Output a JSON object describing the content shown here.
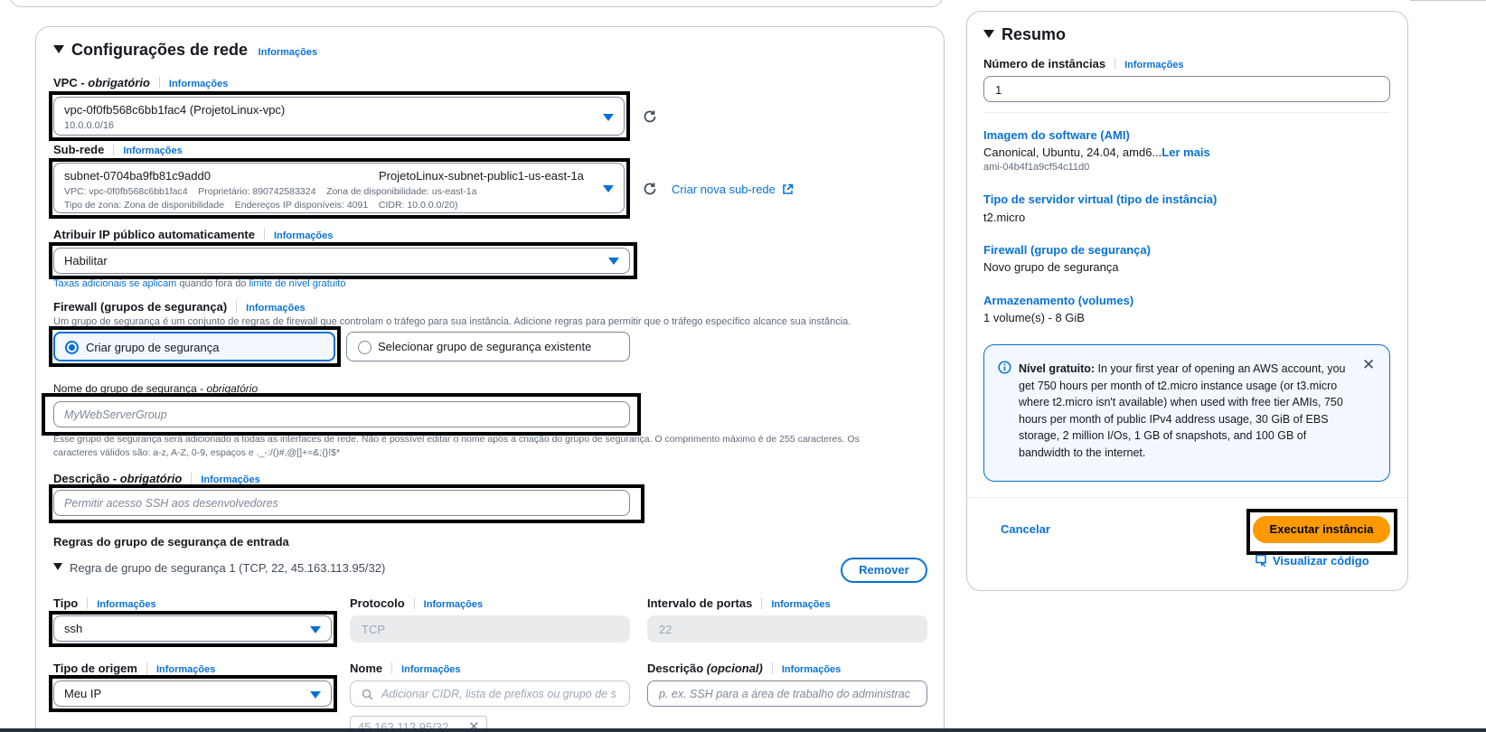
{
  "network": {
    "title": "Configurações de rede",
    "info": "Informações",
    "vpc": {
      "label_main": "VPC - ",
      "label_req": "obrigatório",
      "info": "Informações",
      "value": "vpc-0f0fb568c6bb1fac4 (ProjetoLinux-vpc)",
      "cidr": "10.0.0.0/16"
    },
    "subnet": {
      "label": "Sub-rede",
      "info": "Informações",
      "id": "subnet-0704ba9fb81c9add0",
      "name": "ProjetoLinux-subnet-public1-us-east-1a",
      "line2": "VPC: vpc-0f0fb568c6bb1fac4    Proprietário: 890742583324    Zona de disponibilidade: us-east-1a",
      "line3": "Tipo de zona: Zona de disponibilidade    Endereços IP disponíveis: 4091    CIDR: 10.0.0.0/20)",
      "create_link": "Criar nova sub-rede"
    },
    "public_ip": {
      "label": "Atribuir IP público automaticamente",
      "info": "Informações",
      "value": "Habilitar",
      "note_link1": "Taxas adicionais se aplicam",
      "note_mid": " quando fora do ",
      "note_link2": "limite de nível gratuito"
    },
    "firewall": {
      "label": "Firewall (grupos de segurança)",
      "info": "Informações",
      "hint": "Um grupo de segurança é um conjunto de regras de firewall que controlam o tráfego para sua instância. Adicione regras para permitir que o tráfego específico alcance sua instância.",
      "option_create": "Criar grupo de segurança",
      "option_select": "Selecionar grupo de segurança existente"
    },
    "sg_name": {
      "label_main": "Nome do grupo de segurança - ",
      "label_req": "obrigatório",
      "placeholder": "MyWebServerGroup",
      "hint1": "Esse grupo de segurança será adicionado a todas as interfaces de rede. Não é possível editar o nome após a criação do grupo de segurança. O comprimento máximo é de 255 caracteres. Os",
      "hint2": "caracteres válidos são: a-z, A-Z, 0-9, espaços e ._-:/()#,@[]+=&;{}!$*"
    },
    "description": {
      "label_main": "Descrição - ",
      "label_req": "obrigatório",
      "info": "Informações",
      "placeholder": "Permitir acesso SSH aos desenvolvedores"
    },
    "inbound": {
      "title": "Regras do grupo de segurança de entrada",
      "rule_title": "Regra de grupo de segurança 1 (TCP, 22, 45.163.113.95/32)",
      "remove": "Remover",
      "type_label": "Tipo",
      "type_info": "Informações",
      "type_value": "ssh",
      "protocol_label": "Protocolo",
      "protocol_info": "Informações",
      "protocol_value": "TCP",
      "port_label": "Intervalo de portas",
      "port_info": "Informações",
      "port_value": "22",
      "source_type_label": "Tipo de origem",
      "source_type_info": "Informações",
      "source_type_value": "Meu IP",
      "name_label": "Nome",
      "name_info": "Informações",
      "name_placeholder": "Adicionar CIDR, lista de prefixos ou grupo de s",
      "desc_label_main": "Descrição ",
      "desc_label_opt": "(opcional)",
      "desc_info": "Informações",
      "desc_placeholder": "p. ex. SSH para a área de trabalho do administrac",
      "token": "45.163.113.95/32"
    }
  },
  "summary": {
    "title": "Resumo",
    "count_label": "Número de instâncias",
    "count_info": "Informações",
    "count_value": "1",
    "ami_label": "Imagem do software (AMI)",
    "ami_value": "Canonical, Ubuntu, 24.04, amd6...",
    "ami_more": "Ler mais",
    "ami_id": "ami-04b4f1a9cf54c11d0",
    "type_label": "Tipo de servidor virtual (tipo de instância)",
    "type_value": "t2.micro",
    "fw_label": "Firewall (grupo de segurança)",
    "fw_value": "Novo grupo de segurança",
    "storage_label": "Armazenamento (volumes)",
    "storage_value": "1 volume(s) - 8 GiB",
    "free_tier_title": "Nível gratuito:",
    "free_tier_text": " In your first year of opening an AWS account, you get 750 hours per month of t2.micro instance usage (or t3.micro where t2.micro isn't available) when used with free tier AMIs, 750 hours per month of public IPv4 address usage, 30 GiB of EBS storage, 2 million I/Os, 1 GB of snapshots, and 100 GB of bandwidth to the internet.",
    "cancel": "Cancelar",
    "launch": "Executar instância",
    "view_code": "Visualizar código"
  },
  "colors": {
    "link": "#0972d3",
    "launch_button": "#ff9900",
    "info_alert_bg": "#f2f8fd"
  }
}
